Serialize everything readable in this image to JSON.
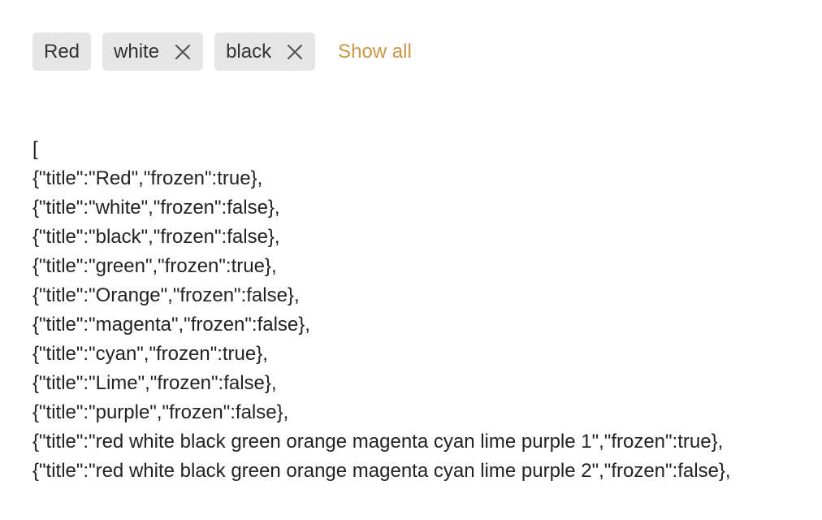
{
  "chips": [
    {
      "label": "Red",
      "removable": false
    },
    {
      "label": "white",
      "removable": true,
      "close_icon": "close-icon"
    },
    {
      "label": "black",
      "removable": true,
      "close_icon": "close-icon"
    }
  ],
  "show_all_label": "Show all",
  "colors": {
    "chip_bg": "#e6e6e6",
    "link": "#c8964a",
    "text": "#222222"
  },
  "json_lines": [
    "[",
    "{\"title\":\"Red\",\"frozen\":true},",
    "{\"title\":\"white\",\"frozen\":false},",
    "{\"title\":\"black\",\"frozen\":false},",
    "{\"title\":\"green\",\"frozen\":true},",
    "{\"title\":\"Orange\",\"frozen\":false},",
    "{\"title\":\"magenta\",\"frozen\":false},",
    "{\"title\":\"cyan\",\"frozen\":true},",
    "{\"title\":\"Lime\",\"frozen\":false},",
    "{\"title\":\"purple\",\"frozen\":false},",
    "{\"title\":\"red white black green orange magenta cyan lime purple 1\",\"frozen\":true},",
    "{\"title\":\"red white black green orange magenta cyan lime purple 2\",\"frozen\":false},"
  ]
}
